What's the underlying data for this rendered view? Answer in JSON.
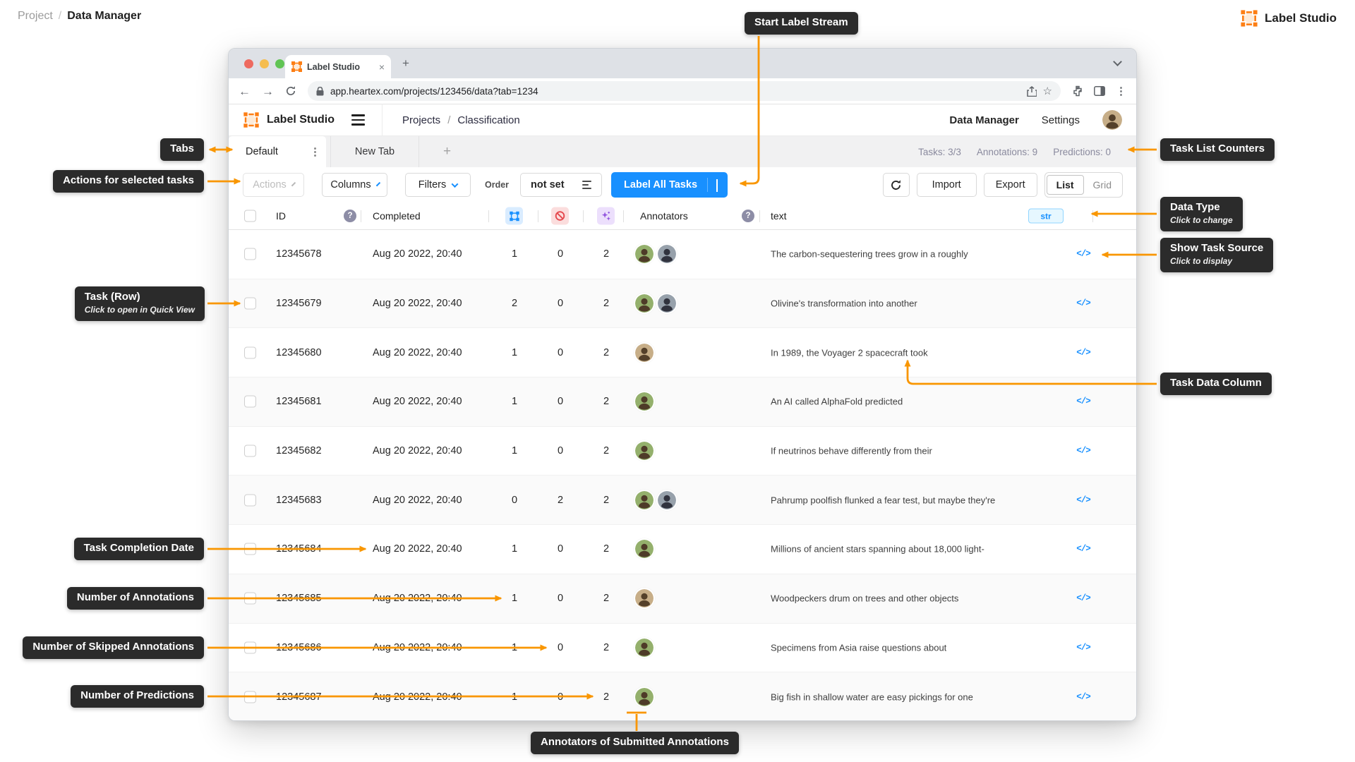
{
  "page": {
    "breadcrumb": {
      "root": "Project",
      "separator": "/",
      "current": "Data Manager"
    },
    "brand": "Label Studio"
  },
  "browser": {
    "tab_title": "Label Studio",
    "url": "app.heartex.com/projects/123456/data?tab=1234"
  },
  "app_header": {
    "logo_text": "Label Studio",
    "breadcrumb_root": "Projects",
    "breadcrumb_sep": "/",
    "breadcrumb_current": "Classification",
    "nav_data_manager": "Data Manager",
    "nav_settings": "Settings"
  },
  "dm_tabs": {
    "active_tab": "Default",
    "second_tab": "New Tab",
    "add_tab": "+",
    "counters": {
      "tasks": "Tasks: 3/3",
      "annotations": "Annotations: 9",
      "predictions": "Predictions: 0"
    }
  },
  "toolbar": {
    "actions": "Actions",
    "columns": "Columns",
    "filters": "Filters",
    "order_label": "Order",
    "order_value": "not set",
    "label_all_tasks": "Label All Tasks",
    "import": "Import",
    "export": "Export",
    "view_list": "List",
    "view_grid": "Grid"
  },
  "table": {
    "headers": {
      "id": "ID",
      "completed": "Completed",
      "annotators": "Annotators",
      "text": "text",
      "data_type": "str"
    },
    "source_icon": "</>",
    "rows": [
      {
        "id": "12345678",
        "completed": "Aug 20 2022, 20:40",
        "annotations": "1",
        "skipped": "0",
        "predictions": "2",
        "annotators": [
          "green",
          "slate"
        ],
        "text": "The carbon-sequestering trees grow in a roughly"
      },
      {
        "id": "12345679",
        "completed": "Aug 20 2022, 20:40",
        "annotations": "2",
        "skipped": "0",
        "predictions": "2",
        "annotators": [
          "green",
          "slate"
        ],
        "text": "Olivine's transformation into another"
      },
      {
        "id": "12345680",
        "completed": "Aug 20 2022, 20:40",
        "annotations": "1",
        "skipped": "0",
        "predictions": "2",
        "annotators": [
          "tan"
        ],
        "text": "In 1989, the Voyager 2 spacecraft took"
      },
      {
        "id": "12345681",
        "completed": "Aug 20 2022, 20:40",
        "annotations": "1",
        "skipped": "0",
        "predictions": "2",
        "annotators": [
          "green"
        ],
        "text": "An AI called AlphaFold predicted"
      },
      {
        "id": "12345682",
        "completed": "Aug 20 2022, 20:40",
        "annotations": "1",
        "skipped": "0",
        "predictions": "2",
        "annotators": [
          "green"
        ],
        "text": "If neutrinos behave differently from their"
      },
      {
        "id": "12345683",
        "completed": "Aug 20 2022, 20:40",
        "annotations": "0",
        "skipped": "2",
        "predictions": "2",
        "annotators": [
          "green",
          "slate"
        ],
        "text": "Pahrump poolfish flunked a fear test, but maybe they're"
      },
      {
        "id": "12345684",
        "completed": "Aug 20 2022, 20:40",
        "annotations": "1",
        "skipped": "0",
        "predictions": "2",
        "annotators": [
          "green"
        ],
        "text": "Millions of ancient stars spanning about 18,000 light-"
      },
      {
        "id": "12345685",
        "completed": "Aug 20 2022, 20:40",
        "annotations": "1",
        "skipped": "0",
        "predictions": "2",
        "annotators": [
          "tan"
        ],
        "text": "Woodpeckers drum on trees and other objects"
      },
      {
        "id": "12345686",
        "completed": "Aug 20 2022, 20:40",
        "annotations": "1",
        "skipped": "0",
        "predictions": "2",
        "annotators": [
          "green"
        ],
        "text": "Specimens from Asia raise questions about"
      },
      {
        "id": "12345687",
        "completed": "Aug 20 2022, 20:40",
        "annotations": "1",
        "skipped": "0",
        "predictions": "2",
        "annotators": [
          "green"
        ],
        "text": "Big fish in shallow water are easy pickings for one"
      }
    ]
  },
  "callouts": {
    "start_label_stream": "Start Label Stream",
    "tabs": "Tabs",
    "actions_selected": "Actions for selected tasks",
    "task_row": {
      "title": "Task (Row)",
      "subtitle": "Click to open in Quick View"
    },
    "task_list_counters": "Task List Counters",
    "data_type": {
      "title": "Data Type",
      "subtitle": "Click to change"
    },
    "show_task_source": {
      "title": "Show Task Source",
      "subtitle": "Click to display"
    },
    "task_data_column": "Task Data Column",
    "completion_date": "Task Completion Date",
    "num_annotations": "Number of Annotations",
    "num_skipped": "Number of Skipped Annotations",
    "num_predictions": "Number of Predictions",
    "annotators_submitted": "Annotators of Submitted Annotations"
  },
  "avatar_palette": {
    "green": {
      "bg": "#94B06C",
      "fg": "#4E3B28"
    },
    "slate": {
      "bg": "#97A1AB",
      "fg": "#31333E"
    },
    "tan": {
      "bg": "#C7AE88",
      "fg": "#54402A"
    }
  },
  "header_avatar": "tan",
  "colors": {
    "accent_blue": "#1890FF",
    "arrow_orange": "#F99600",
    "logo_orange": "#FD7E14",
    "callout_bg": "#2B2B2B",
    "skipped_red": "#E5484D",
    "predictions_purple": "#9254DE",
    "counter_text": "#8A8A9E"
  }
}
